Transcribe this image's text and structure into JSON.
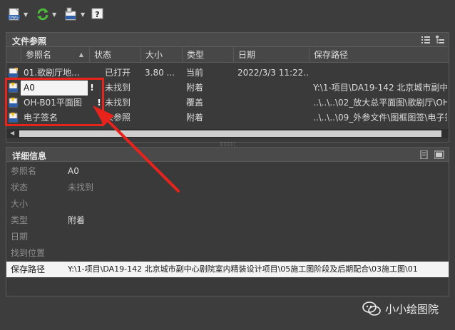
{
  "toolbar": {
    "buttons": [
      {
        "icon": "dwg-attach-icon",
        "has_dropdown": true
      },
      {
        "icon": "refresh-icon",
        "has_dropdown": true
      },
      {
        "icon": "change-path-icon",
        "has_dropdown": true
      },
      {
        "icon": "help-icon",
        "has_dropdown": false
      }
    ]
  },
  "file_refs": {
    "title": "文件参照",
    "columns": [
      "参照名",
      "状态",
      "大小",
      "类型",
      "日期",
      "保存路径"
    ],
    "sort_indicator": "▲",
    "rows": [
      {
        "name": "01.歌剧厅地...",
        "status": "已打开",
        "size": "3.80 ...",
        "type": "当前",
        "date": "2022/3/3 11:22...",
        "path": "",
        "warning": false,
        "icon": "dwg-current-icon"
      },
      {
        "name": "A0",
        "status": "未找到",
        "size": "",
        "type": "附着",
        "date": "",
        "path": "Y:\\1-项目\\DA19-142 北京城市副中",
        "warning": true,
        "icon": "dwg-missing-icon"
      },
      {
        "name": "OH-B01平面图",
        "status": "未找到",
        "size": "",
        "type": "覆盖",
        "date": "",
        "path": "..\\..\\..\\02_放大总平面图\\歌剧厅\\OH",
        "warning": true,
        "icon": "dwg-missing-icon"
      },
      {
        "name": "电子签名",
        "status": "未参照",
        "size": "",
        "type": "附着",
        "date": "",
        "path": "..\\..\\..\\09_外参文件\\图框图签\\电子签",
        "warning": false,
        "icon": "dwg-missing-icon"
      }
    ],
    "warning_mark": "!"
  },
  "details": {
    "title": "详细信息",
    "fields": [
      {
        "label": "参照名",
        "value": "A0"
      },
      {
        "label": "状态",
        "value": "未找到"
      },
      {
        "label": "大小",
        "value": ""
      },
      {
        "label": "类型",
        "value": "附着"
      },
      {
        "label": "日期",
        "value": ""
      },
      {
        "label": "找到位置",
        "value": ""
      },
      {
        "label": "保存路径",
        "value": "Y:\\1-项目\\DA19-142 北京城市副中心剧院室内精装设计项目\\05施工图阶段及后期配合\\03施工图\\01"
      }
    ]
  },
  "watermark": {
    "text": "小小绘图院"
  },
  "colors": {
    "annotation": "#e8231c",
    "background": "#3d3d3d"
  }
}
